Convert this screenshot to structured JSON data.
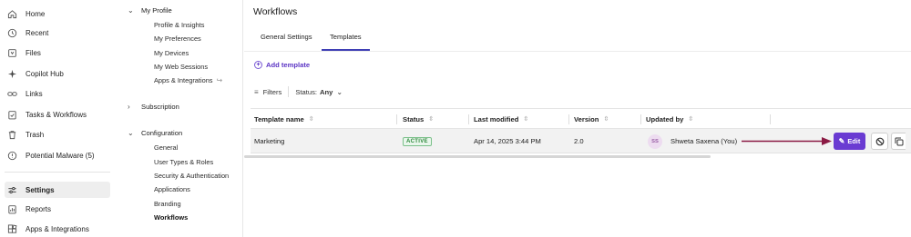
{
  "leftnav": {
    "items": [
      {
        "label": "Home",
        "icon": "home-icon"
      },
      {
        "label": "Recent",
        "icon": "clock-icon"
      },
      {
        "label": "Files",
        "icon": "file-box-icon"
      },
      {
        "label": "Copilot Hub",
        "icon": "sparkle-icon"
      },
      {
        "label": "Links",
        "icon": "link-icon"
      },
      {
        "label": "Tasks & Workflows",
        "icon": "clipboard-check-icon"
      },
      {
        "label": "Trash",
        "icon": "trash-icon"
      },
      {
        "label": "Potential Malware (5)",
        "icon": "alert-shield-icon"
      },
      {
        "label": "Settings",
        "icon": "sliders-icon",
        "active": true
      },
      {
        "label": "Reports",
        "icon": "report-icon"
      },
      {
        "label": "Apps & Integrations",
        "icon": "apps-icon"
      }
    ]
  },
  "subnav": {
    "my_profile": {
      "label": "My Profile",
      "children": [
        "Profile & Insights",
        "My Preferences",
        "My Devices",
        "My Web Sessions",
        "Apps & Integrations"
      ]
    },
    "subscription": {
      "label": "Subscription"
    },
    "configuration": {
      "label": "Configuration",
      "children": [
        "General",
        "User Types & Roles",
        "Security & Authentication",
        "Applications",
        "Branding",
        "Workflows"
      ],
      "active_child": "Workflows"
    }
  },
  "main": {
    "title": "Workflows",
    "tabs": [
      {
        "label": "General Settings",
        "active": false
      },
      {
        "label": "Templates",
        "active": true
      }
    ],
    "add_template_label": "Add template",
    "filters": {
      "label": "Filters",
      "status_label": "Status:",
      "status_value": "Any"
    },
    "table": {
      "columns": [
        "Template name",
        "Status",
        "Last modified",
        "Version",
        "Updated by"
      ],
      "rows": [
        {
          "template_name": "Marketing",
          "status": "ACTIVE",
          "last_modified": "Apr 14, 2025 3:44 PM",
          "version": "2.0",
          "updated_by_initials": "SS",
          "updated_by": "Shweta Saxena (You)"
        }
      ]
    },
    "edit_label": "Edit",
    "colors": {
      "accent": "#6a3bd2",
      "arrow": "#8b1a44",
      "status_active": "#2f8a3c"
    }
  }
}
